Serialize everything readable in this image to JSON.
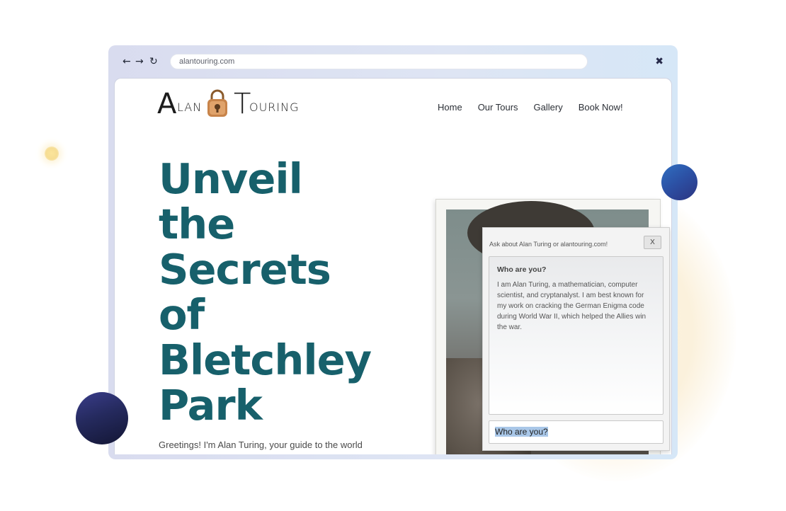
{
  "browser": {
    "url": "alantouring.com",
    "back_icon": "←",
    "forward_icon": "→",
    "reload_icon": "↻",
    "close_icon": "✖"
  },
  "site": {
    "logo": {
      "letter_a": "A",
      "letters_lan": "LAN",
      "letter_t": "T",
      "letters_ouring": "OURING"
    },
    "nav": [
      "Home",
      "Our Tours",
      "Gallery",
      "Book Now!"
    ],
    "hero": {
      "title_lines": [
        "Unveil",
        "the",
        "Secrets",
        "of",
        "Bletchley",
        "Park"
      ],
      "subtitle": "Greetings! I'm Alan Turing, your guide to the world"
    }
  },
  "chat": {
    "header": "Ask about Alan Turing or alantouring.com!",
    "close_label": "X",
    "question": "Who are you?",
    "answer": "I am Alan Turing, a mathematician, computer scientist, and cryptanalyst. I am best known for my work on cracking the German Enigma code during World War II, which helped the Allies win the war.",
    "input_value": "Who are you?"
  },
  "colors": {
    "title": "#17606b",
    "ball_blue": "#2c4fa3",
    "ball_dark": "#1f2350",
    "browser_frame": "#dbe1f2"
  }
}
